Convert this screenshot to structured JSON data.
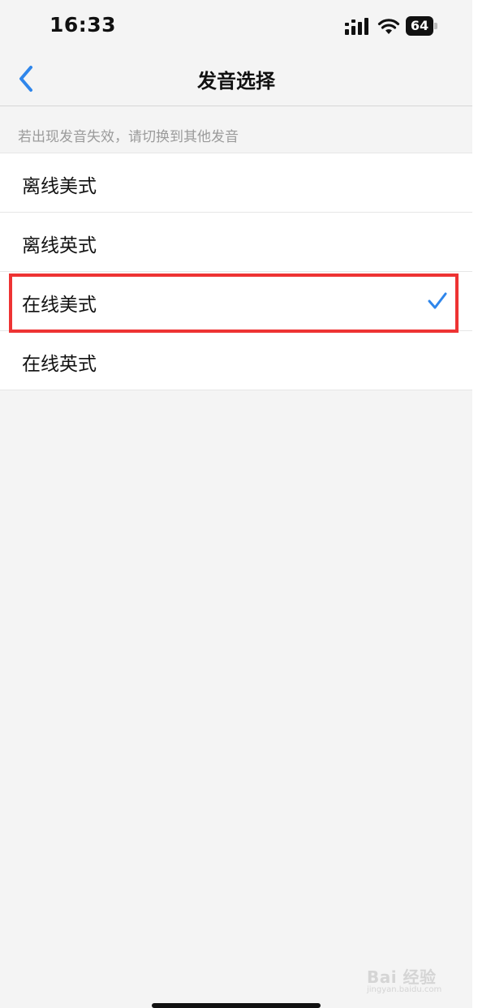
{
  "status_bar": {
    "time": "16:33",
    "battery_level": "64",
    "icons": [
      "signal-icon",
      "wifi-icon",
      "battery-icon"
    ]
  },
  "nav": {
    "title": "发音选择",
    "back_icon": "chevron-left-icon"
  },
  "hint": "若出现发音失效，请切换到其他发音",
  "options": [
    {
      "label": "离线美式",
      "selected": false
    },
    {
      "label": "离线英式",
      "selected": false
    },
    {
      "label": "在线美式",
      "selected": true
    },
    {
      "label": "在线英式",
      "selected": false
    }
  ],
  "watermark": {
    "text": "Bai  经验",
    "sub": "jingyan.baidu.com"
  },
  "colors": {
    "accent": "#2f86eb",
    "highlight_border": "#ee3333",
    "background": "#f4f4f4",
    "hint_text": "#9b9b9b"
  }
}
